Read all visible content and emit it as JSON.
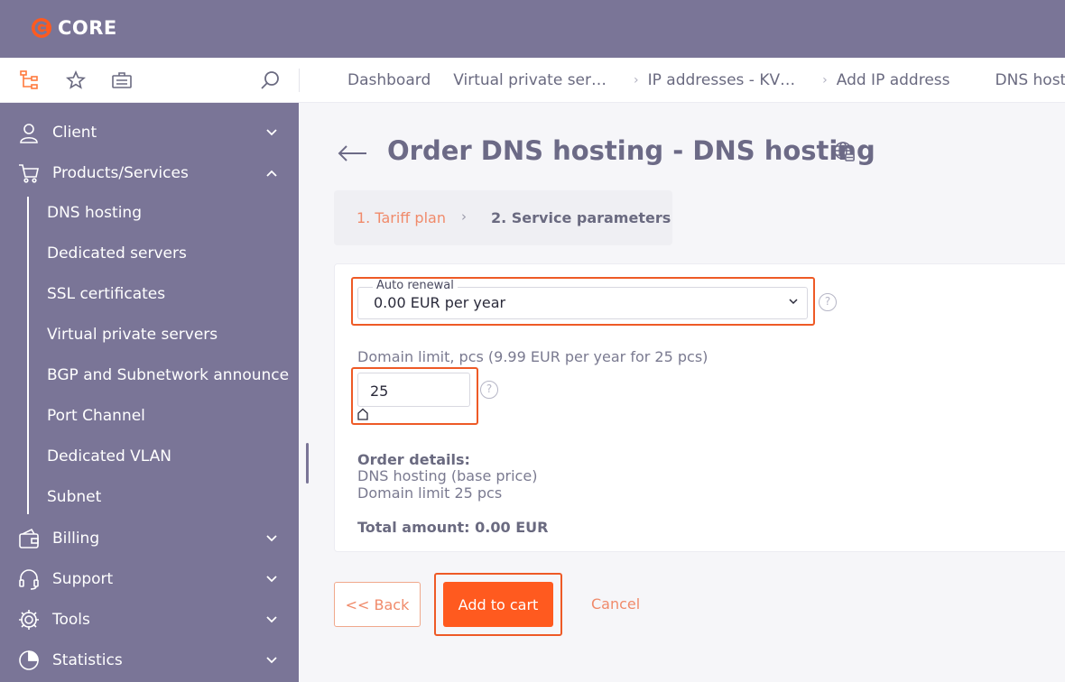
{
  "app": {
    "name": "CORE"
  },
  "breadcrumbs": [
    {
      "label": "Dashboard"
    },
    {
      "label": "Virtual private ser…"
    },
    {
      "label": "IP addresses - KV…"
    },
    {
      "label": "Add IP address"
    },
    {
      "label": "DNS hosting"
    }
  ],
  "sidebar": {
    "sections": [
      {
        "label": "Client",
        "icon": "client-icon",
        "expanded": false
      },
      {
        "label": "Products/Services",
        "icon": "cart-icon",
        "expanded": true
      },
      {
        "label": "Billing",
        "icon": "wallet-icon",
        "expanded": false
      },
      {
        "label": "Support",
        "icon": "headset-icon",
        "expanded": false
      },
      {
        "label": "Tools",
        "icon": "gear-icon",
        "expanded": false
      },
      {
        "label": "Statistics",
        "icon": "pie-chart-icon",
        "expanded": false
      }
    ],
    "subitems": [
      "DNS hosting",
      "Dedicated servers",
      "SSL certificates",
      "Virtual private servers",
      "BGP and Subnetwork announce",
      "Port Channel",
      "Dedicated VLAN",
      "Subnet"
    ]
  },
  "page": {
    "title": "Order DNS hosting - DNS hosting"
  },
  "steps": {
    "step1": "1. Tariff plan",
    "step2": "2. Service parameters"
  },
  "form": {
    "auto_renewal": {
      "label": "Auto renewal",
      "value": "0.00 EUR per year"
    },
    "domain_limit": {
      "label": "Domain limit, pcs (9.99 EUR per year for 25 pcs)",
      "value": "25"
    },
    "help_glyph": "?"
  },
  "order": {
    "title": "Order details:",
    "lines": [
      "DNS hosting (base price)",
      "Domain limit 25 pcs"
    ],
    "total": "Total amount: 0.00 EUR"
  },
  "buttons": {
    "back": "<< Back",
    "add": "Add to cart",
    "cancel": "Cancel"
  },
  "colors": {
    "sidebar": "#7a7597",
    "accent": "#ff5a1f",
    "highlight": "#ee5a26",
    "step_active": "#f08a6a"
  }
}
